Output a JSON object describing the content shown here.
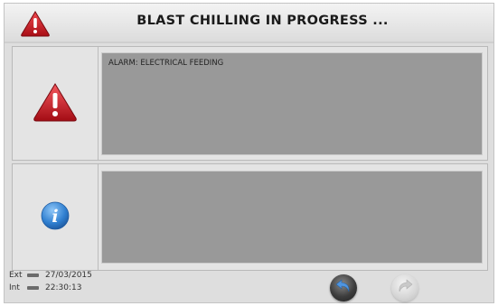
{
  "header": {
    "title": "BLAST CHILLING IN PROGRESS ...",
    "icon": "warning-triangle-icon"
  },
  "alarm_panel": {
    "icon": "warning-triangle-icon",
    "message": "ALARM: ELECTRICAL FEEDING"
  },
  "info_panel": {
    "icon": "info-icon",
    "message": ""
  },
  "footer": {
    "ext_label": "Ext",
    "int_label": "Int",
    "date": "27/03/2015",
    "time": "22:30:13",
    "back_icon": "back-arrow-icon",
    "forward_icon": "forward-arrow-icon"
  },
  "colors": {
    "warning_red": "#c8141e",
    "info_blue": "#2f7fd0",
    "message_box": "#999999"
  }
}
